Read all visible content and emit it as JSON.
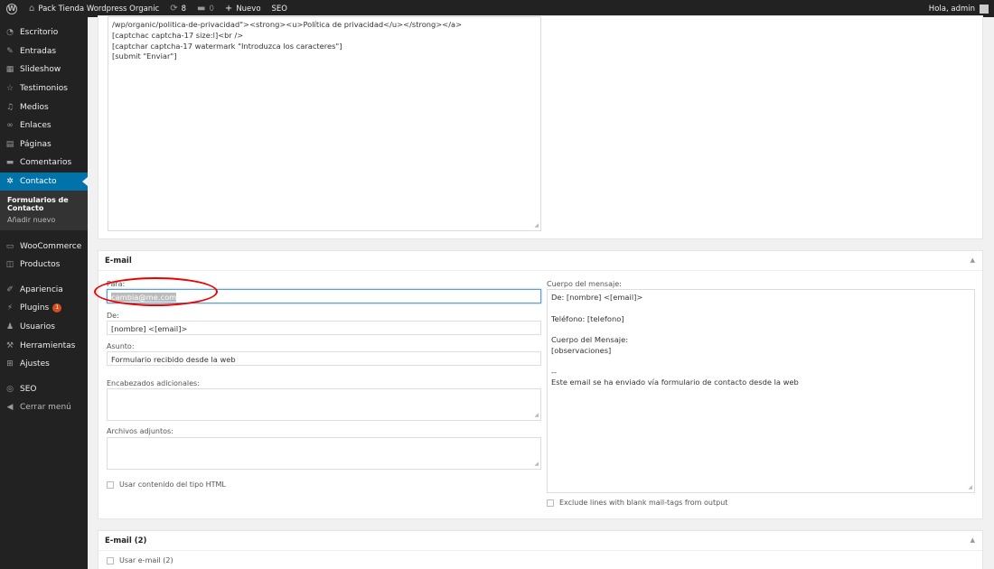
{
  "adminbar": {
    "site_name": "Pack Tienda Wordpress Organic",
    "updates_count": "8",
    "comments_count": "0",
    "new_label": "Nuevo",
    "seo_label": "SEO",
    "greeting": "Hola, admin"
  },
  "sidebar": {
    "items": [
      {
        "icon": "dashboard-icon",
        "glyph": "◔",
        "label": "Escritorio"
      },
      {
        "icon": "pin-icon",
        "glyph": "✎",
        "label": "Entradas"
      },
      {
        "icon": "slideshow-icon",
        "glyph": "▦",
        "label": "Slideshow"
      },
      {
        "icon": "star-icon",
        "glyph": "☆",
        "label": "Testimonios"
      },
      {
        "icon": "media-icon",
        "glyph": "♫",
        "label": "Medios"
      },
      {
        "icon": "link-icon",
        "glyph": "∞",
        "label": "Enlaces"
      },
      {
        "icon": "pages-icon",
        "glyph": "▤",
        "label": "Páginas"
      },
      {
        "icon": "comments-icon",
        "glyph": "▬",
        "label": "Comentarios"
      },
      {
        "icon": "gear-icon",
        "glyph": "✲",
        "label": "Contacto"
      }
    ],
    "submenu": [
      "Formularios de Contacto",
      "Añadir nuevo"
    ],
    "items2": [
      {
        "icon": "woocommerce-icon",
        "glyph": "▭",
        "label": "WooCommerce"
      },
      {
        "icon": "products-icon",
        "glyph": "◫",
        "label": "Productos"
      }
    ],
    "items3": [
      {
        "icon": "brush-icon",
        "glyph": "✐",
        "label": "Apariencia"
      },
      {
        "icon": "plugin-icon",
        "glyph": "⚡",
        "label": "Plugins",
        "badge": "1"
      },
      {
        "icon": "users-icon",
        "glyph": "♟",
        "label": "Usuarios"
      },
      {
        "icon": "wrench-icon",
        "glyph": "⚒",
        "label": "Herramientas"
      },
      {
        "icon": "settings-icon",
        "glyph": "⊞",
        "label": "Ajustes"
      }
    ],
    "items4": [
      {
        "icon": "seo-icon",
        "glyph": "◎",
        "label": "SEO"
      },
      {
        "icon": "collapse-icon",
        "glyph": "◀",
        "label": "Cerrar menú"
      }
    ]
  },
  "form_code": {
    "lines": [
      "/wp/organic/politica-de-privacidad\"><strong><u>Política de privacidad</u></strong></a>",
      "[captchac captcha-17 size:l]<br />",
      "[captchar captcha-17 watermark \"Introduzca los caracteres\"]",
      "[submit \"Enviar\"]"
    ]
  },
  "email": {
    "title": "E-mail",
    "to_label": "Para:",
    "to_value": "cambia@me.com",
    "from_label": "De:",
    "from_value": "[nombre] <[email]>",
    "subject_label": "Asunto:",
    "subject_value": "Formulario recibido desde la web",
    "headers_label": "Encabezados adicionales:",
    "attachments_label": "Archivos adjuntos:",
    "html_checkbox": "Usar contenido del tipo HTML",
    "body_label": "Cuerpo del mensaje:",
    "body_lines": [
      "De: [nombre] <[email]>",
      "",
      "Teléfono: [telefono]",
      "",
      "Cuerpo del Mensaje:",
      "[observaciones]",
      "",
      "--",
      "Este email se ha enviado vía formulario de contacto desde la web"
    ],
    "exclude_checkbox": "Exclude lines with blank mail-tags from output"
  },
  "email2": {
    "title": "E-mail (2)",
    "use_checkbox": "Usar e-mail (2)"
  }
}
